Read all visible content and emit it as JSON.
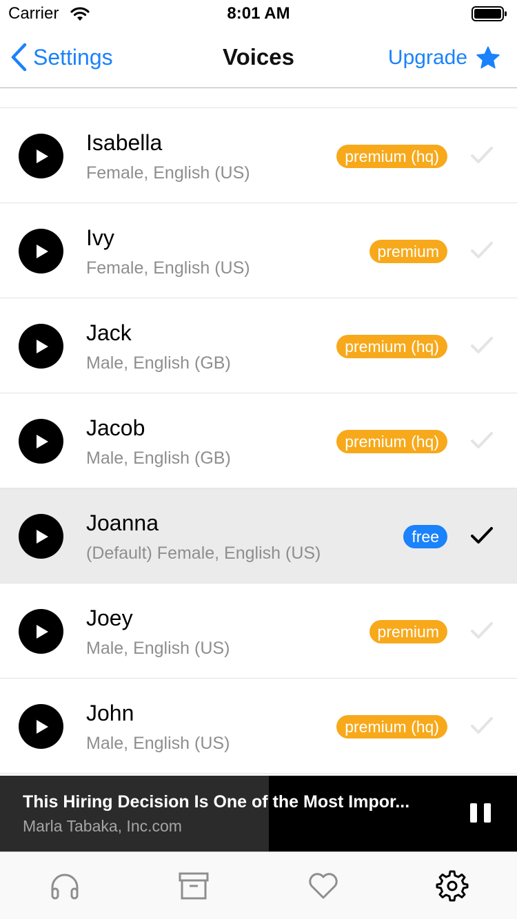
{
  "status_bar": {
    "carrier": "Carrier",
    "time": "8:01 AM"
  },
  "nav": {
    "back_label": "Settings",
    "title": "Voices",
    "upgrade_label": "Upgrade"
  },
  "voices": [
    {
      "name": "Isabella",
      "desc": "Female, English (US)",
      "badge": "premium (hq)",
      "badge_color": "#f7a91b",
      "selected": false
    },
    {
      "name": "Ivy",
      "desc": "Female, English (US)",
      "badge": "premium",
      "badge_color": "#f7a91b",
      "selected": false
    },
    {
      "name": "Jack",
      "desc": "Male, English (GB)",
      "badge": "premium (hq)",
      "badge_color": "#f7a91b",
      "selected": false
    },
    {
      "name": "Jacob",
      "desc": "Male, English (GB)",
      "badge": "premium (hq)",
      "badge_color": "#f7a91b",
      "selected": false
    },
    {
      "name": "Joanna",
      "desc": "(Default) Female, English (US)",
      "badge": "free",
      "badge_color": "#1a82fb",
      "selected": true
    },
    {
      "name": "Joey",
      "desc": "Male, English (US)",
      "badge": "premium",
      "badge_color": "#f7a91b",
      "selected": false
    },
    {
      "name": "John",
      "desc": "Male, English (US)",
      "badge": "premium (hq)",
      "badge_color": "#f7a91b",
      "selected": false
    }
  ],
  "player": {
    "title": "This Hiring Decision Is One of the Most Impor...",
    "source": "Marla Tabaka, Inc.com",
    "progress": 0.52
  },
  "tabs": [
    {
      "icon": "headphones-icon",
      "active": false
    },
    {
      "icon": "archive-icon",
      "active": false
    },
    {
      "icon": "heart-icon",
      "active": false
    },
    {
      "icon": "gear-icon",
      "active": true
    }
  ],
  "colors": {
    "accent": "#1a82fb",
    "premium": "#f7a91b",
    "selected_row": "#ebebeb",
    "inactive_tab": "#8e8e8e"
  }
}
